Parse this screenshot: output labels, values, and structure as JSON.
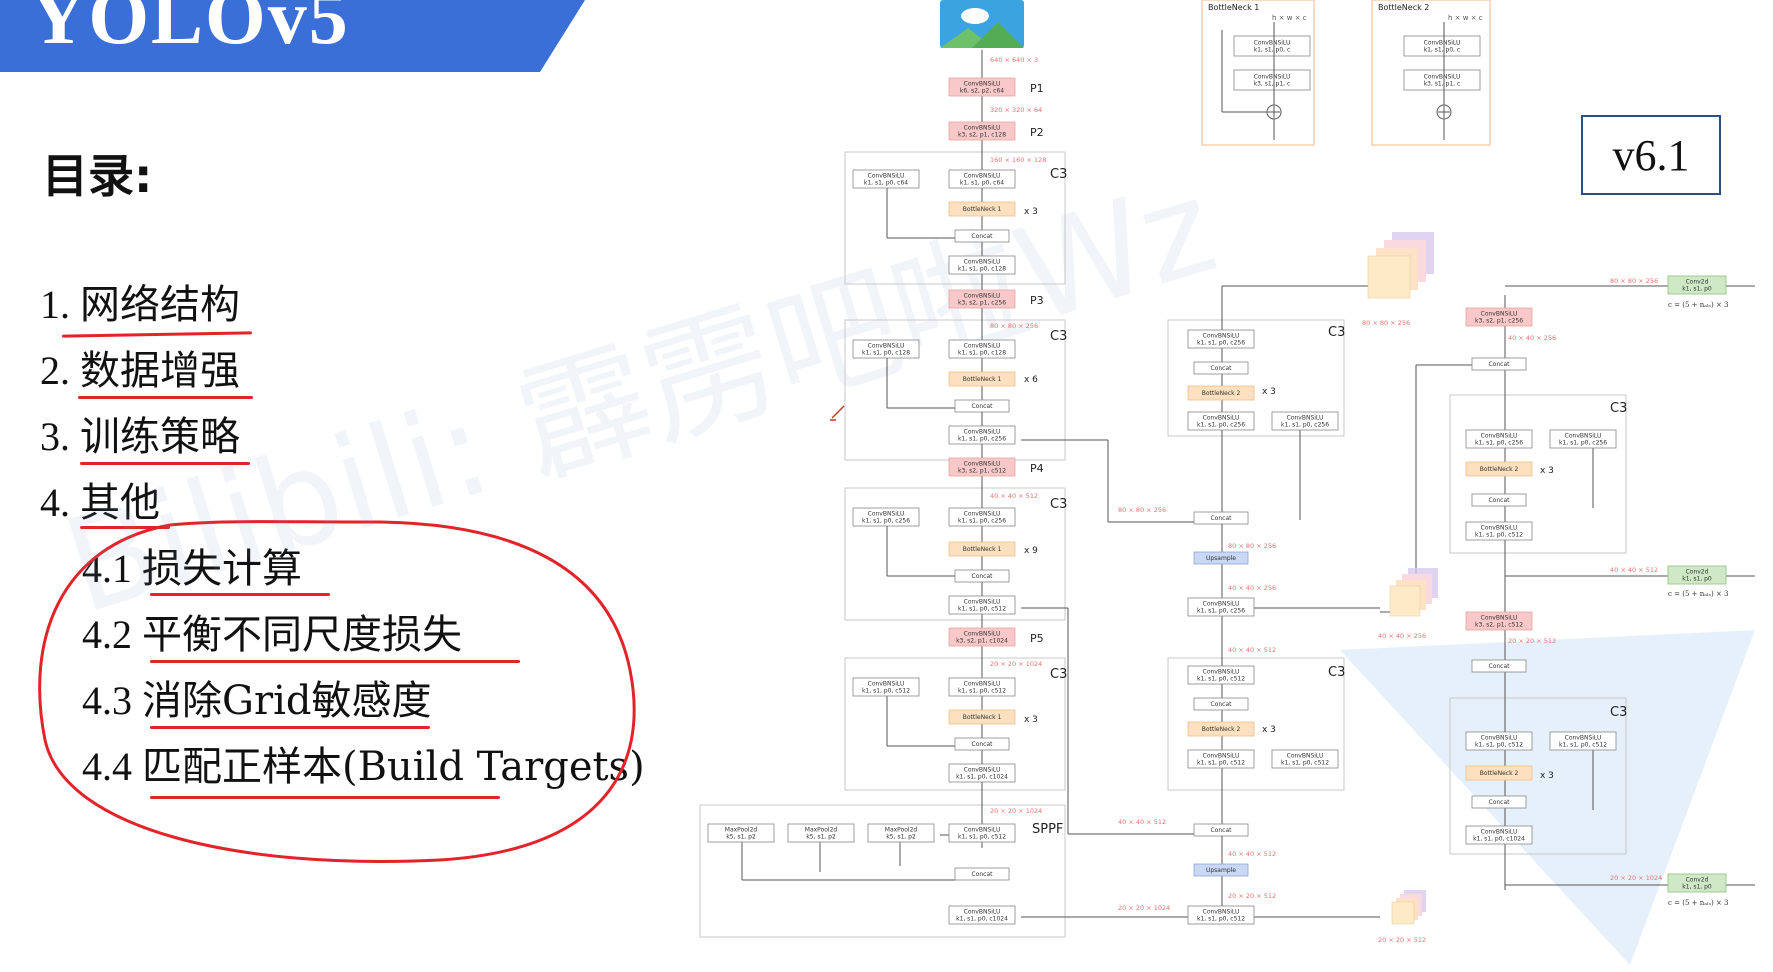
{
  "banner": {
    "title": "YOLOv5",
    "color": "#3a6fd8"
  },
  "toc": {
    "heading": "目录:",
    "items": [
      {
        "num": "1.",
        "text": "网络结构"
      },
      {
        "num": "2.",
        "text": "数据增强"
      },
      {
        "num": "3.",
        "text": "训练策略"
      },
      {
        "num": "4.",
        "text": "其他"
      },
      {
        "num": "4.1",
        "text": "损失计算"
      },
      {
        "num": "4.2",
        "text": "平衡不同尺度损失"
      },
      {
        "num": "4.3",
        "text": "消除Grid敏感度"
      },
      {
        "num": "4.4",
        "text": "匹配正样本(Build Targets)"
      }
    ]
  },
  "version": "v6.1",
  "watermark": "Bilibili: 霹雳吧啦Wz",
  "diagram": {
    "labels": {
      "p1": "P1",
      "p2": "P2",
      "p3": "P3",
      "p4": "P4",
      "p5": "P5",
      "c3": "C3",
      "sppf": "SPPF",
      "x3": "x 3",
      "x6": "x 6",
      "x9": "x 9"
    },
    "bottleneck1": {
      "title": "BottleNeck 1",
      "dims": "h × w × c",
      "conv1": [
        "ConvBNSiLU",
        "k1, s1, p0, c"
      ],
      "conv2": [
        "ConvBNSiLU",
        "k3, s1, p1, c"
      ]
    },
    "bottleneck2": {
      "title": "BottleNeck 2",
      "dims": "h × w × c",
      "conv1": [
        "ConvBNSiLU",
        "k1, s1, p0, c"
      ],
      "conv2": [
        "ConvBNSiLU",
        "k3, s1, p1, c"
      ]
    },
    "dims": {
      "input": "640 × 640 × 3",
      "d320": "320 × 320 × 64",
      "d160": "160 × 160 × 128",
      "d80": "80 × 80 × 256",
      "d40": "40 × 40 × 512",
      "d20": "20 × 20 × 1024",
      "d20b": "20 × 20 × 1024",
      "n80": "80 × 80 × 256",
      "n40": "40 × 40 × 512",
      "n40b": "40 × 40 × 256",
      "n20": "20 × 20 × 512",
      "n80b": "80 × 80 × 256",
      "out80": "80 × 80 × 256",
      "out40": "40 × 40 × 512",
      "out20": "20 × 20 × 1024",
      "side80": "80 × 80 × 256",
      "side40": "40 × 40 × 256",
      "side20": "20 × 20 × 512",
      "h40": "40 × 40 × 256",
      "h20": "20 × 20 × 512",
      "m40": "40 × 40 × 512",
      "m20": "20 × 20 × 512",
      "m20b": "20 × 20 × 1024",
      "n80c": "80 × 80 × 256"
    },
    "backbone": {
      "conv_p1": [
        "ConvBNSiLU",
        "k6, s2, p2, c64"
      ],
      "conv_p2": [
        "ConvBNSiLU",
        "k3, s2, p1, c128"
      ],
      "c3a_left": [
        "ConvBNSiLU",
        "k1, s1, p0, c64"
      ],
      "c3a_right": [
        "ConvBNSiLU",
        "k1, s1, p0, c64"
      ],
      "c3a_bn": [
        "BottleNeck 1"
      ],
      "c3a_concat": [
        "Concat"
      ],
      "c3a_out": [
        "ConvBNSiLU",
        "k1, s1, p0, c128"
      ],
      "conv_p3": [
        "ConvBNSiLU",
        "k3, s2, p1, c256"
      ],
      "c3b_left": [
        "ConvBNSiLU",
        "k1, s1, p0, c128"
      ],
      "c3b_right": [
        "ConvBNSiLU",
        "k1, s1, p0, c128"
      ],
      "c3b_bn": [
        "BottleNeck 1"
      ],
      "c3b_concat": [
        "Concat"
      ],
      "c3b_out": [
        "ConvBNSiLU",
        "k1, s1, p0, c256"
      ],
      "conv_p4": [
        "ConvBNSiLU",
        "k3, s2, p1, c512"
      ],
      "c3c_left": [
        "ConvBNSiLU",
        "k1, s1, p0, c256"
      ],
      "c3c_right": [
        "ConvBNSiLU",
        "k1, s1, p0, c256"
      ],
      "c3c_bn": [
        "BottleNeck 1"
      ],
      "c3c_concat": [
        "Concat"
      ],
      "c3c_out": [
        "ConvBNSiLU",
        "k1, s1, p0, c512"
      ],
      "conv_p5": [
        "ConvBNSiLU",
        "k3, s2, p1, c1024"
      ],
      "c3d_left": [
        "ConvBNSiLU",
        "k1, s1, p0, c512"
      ],
      "c3d_right": [
        "ConvBNSiLU",
        "k1, s1, p0, c512"
      ],
      "c3d_bn": [
        "BottleNeck 1"
      ],
      "c3d_concat": [
        "Concat"
      ],
      "c3d_out": [
        "ConvBNSiLU",
        "k1, s1, p0, c1024"
      ],
      "sppf_conv_in": [
        "ConvBNSiLU",
        "k1, s1, p0, c512"
      ],
      "sppf_mp1": [
        "MaxPool2d",
        "k5, s1, p2"
      ],
      "sppf_mp2": [
        "MaxPool2d",
        "k5, s1, p2"
      ],
      "sppf_mp3": [
        "MaxPool2d",
        "k5, s1, p2"
      ],
      "sppf_concat": [
        "Concat"
      ],
      "sppf_out": [
        "ConvBNSiLU",
        "k1, s1, p0, c1024"
      ]
    },
    "neck": {
      "n_c3a_left": [
        "ConvBNSiLU",
        "k1, s1, p0, c256"
      ],
      "n_c3a_concat": [
        "Concat"
      ],
      "n_c3a_bn": [
        "BottleNeck 2"
      ],
      "n_c3a_in": [
        "ConvBNSiLU",
        "k1, s1, p0, c256"
      ],
      "n_c3a_right": [
        "ConvBNSiLU",
        "k1, s1, p0, c256"
      ],
      "n_concat1": [
        "Concat"
      ],
      "n_upsample1": [
        "Upsample"
      ],
      "n_conv1": [
        "ConvBNSiLU",
        "k1, s1, p0, c256"
      ],
      "n_c3b_top": [
        "ConvBNSiLU",
        "k1, s1, p0, c512"
      ],
      "n_c3b_concat": [
        "Concat"
      ],
      "n_c3b_bn": [
        "BottleNeck 2"
      ],
      "n_c3b_in": [
        "ConvBNSiLU",
        "k1, s1, p0, c512"
      ],
      "n_c3b_right": [
        "ConvBNSiLU",
        "k1, s1, p0, c512"
      ],
      "n_concat2": [
        "Concat"
      ],
      "n_upsample2": [
        "Upsample"
      ],
      "n_conv2": [
        "ConvBNSiLU",
        "k1, s1, p0, c512"
      ],
      "r_conv1": [
        "ConvBNSiLU",
        "k3, s2, p1, c256"
      ],
      "r_concat1": [
        "Concat"
      ],
      "r_c3a_left": [
        "ConvBNSiLU",
        "k1, s1, p0, c256"
      ],
      "r_c3a_right": [
        "ConvBNSiLU",
        "k1, s1, p0, c256"
      ],
      "r_c3a_bn": [
        "BottleNeck 2"
      ],
      "r_c3a_concat": [
        "Concat"
      ],
      "r_c3a_out": [
        "ConvBNSiLU",
        "k1, s1, p0, c512"
      ],
      "r_conv2": [
        "ConvBNSiLU",
        "k3, s2, p1, c512"
      ],
      "r_concat2": [
        "Concat"
      ],
      "r_c3b_left": [
        "ConvBNSiLU",
        "k1, s1, p0, c512"
      ],
      "r_c3b_right": [
        "ConvBNSiLU",
        "k1, s1, p0, c512"
      ],
      "r_c3b_bn": [
        "BottleNeck 2"
      ],
      "r_c3b_concat": [
        "Concat"
      ],
      "r_c3b_out": [
        "ConvBNSiLU",
        "k1, s1, p0, c1024"
      ]
    },
    "heads": {
      "h1": [
        "Conv2d",
        "k1, s1, p0"
      ],
      "h2": [
        "Conv2d",
        "k1, s1, p0"
      ],
      "h3": [
        "Conv2d",
        "k1, s1, p0"
      ],
      "formula": "c = (5 + nₐₗₛ) × 3"
    }
  }
}
